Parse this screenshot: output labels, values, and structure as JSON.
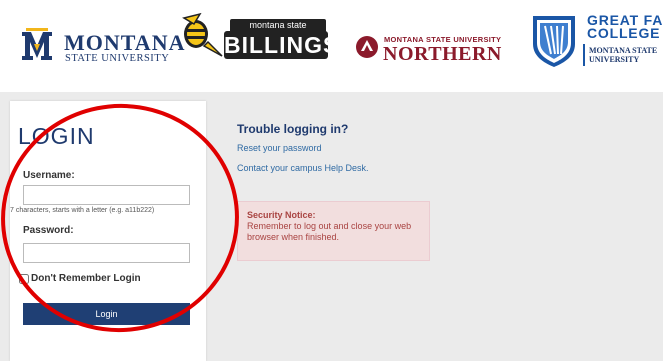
{
  "header": {
    "msu": {
      "line1": "MONTANA",
      "line2": "STATE UNIVERSITY"
    },
    "billings": {
      "line1": "montana state university",
      "line2": "BILLINGS"
    },
    "northern": {
      "line1": "MONTANA STATE UNIVERSITY",
      "line2": "NORTHERN"
    },
    "gfc": {
      "line1": "GREAT FALLS",
      "line2": "COLLEGE",
      "line3": "MONTANA STATE",
      "line4": "UNIVERSITY"
    }
  },
  "login": {
    "title": "LOGIN",
    "username_label": "Username:",
    "username_value": "",
    "username_hint": "7 characters, starts with a letter (e.g. a11b222)",
    "password_label": "Password:",
    "password_value": "",
    "remember_label": "Don't Remember Login",
    "remember_checked": false,
    "button_label": "Login"
  },
  "help": {
    "heading": "Trouble logging in?",
    "reset_link": "Reset your password",
    "helpdesk_link": "Contact your campus Help Desk."
  },
  "notice": {
    "title": "Security Notice:",
    "body": "Remember to log out and close your web browser when finished."
  },
  "colors": {
    "brand_navy": "#1f3a6e",
    "button_navy": "#1f3f74",
    "link_blue": "#2f6aa3",
    "notice_bg": "#f2dede",
    "notice_text": "#a94442",
    "annotation_red": "#e00000"
  },
  "annotation": {
    "shape": "ellipse",
    "color": "#e00000",
    "target": "login-form"
  }
}
